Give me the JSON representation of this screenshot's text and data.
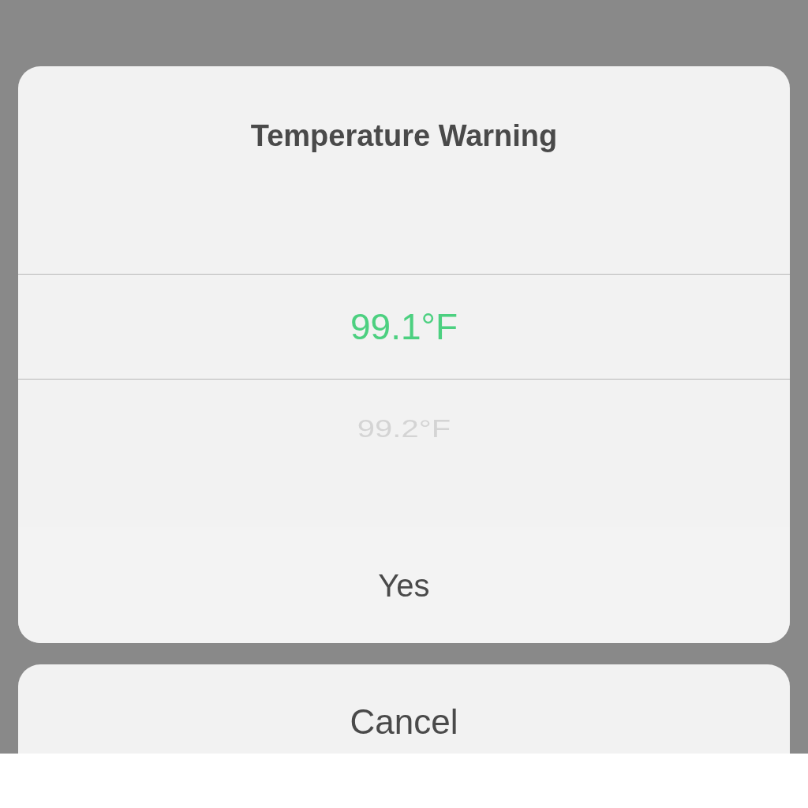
{
  "alert": {
    "title": "Temperature Warning",
    "picker": [
      {
        "label": "99.1°F",
        "selected": true
      },
      {
        "label": "99.2°F",
        "selected": false
      }
    ],
    "confirm": "Yes"
  },
  "cancel": "Cancel"
}
